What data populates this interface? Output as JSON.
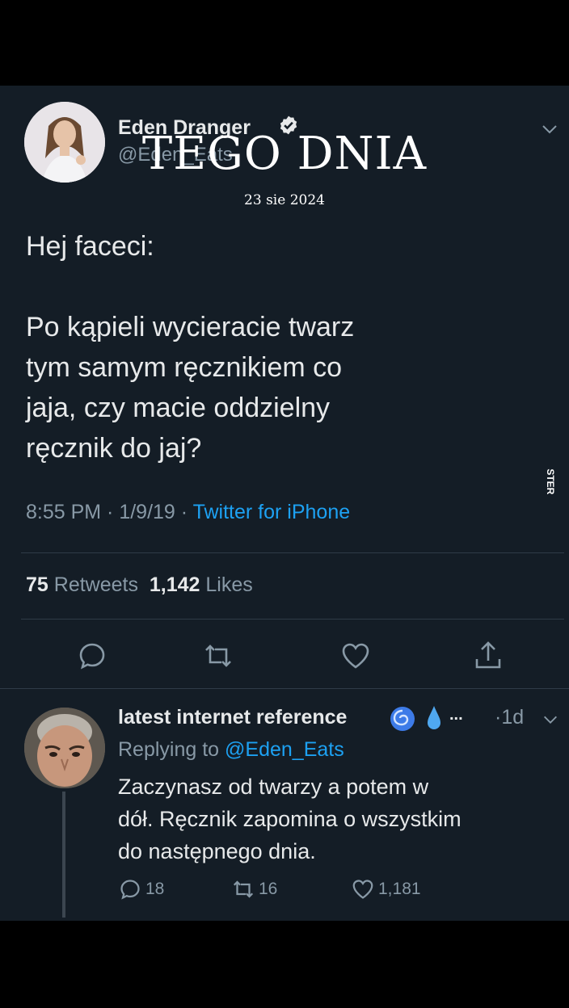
{
  "overlay": {
    "title": "TEGO DNIA",
    "date": "23 sie 2024"
  },
  "tweet": {
    "author_name": "Eden Dranger",
    "author_handle": "@Eden_Eats",
    "text_lines": [
      "Hej faceci:",
      "Po kąpieli wycieracie twarz",
      "tym samym ręcznikiem co",
      "jaja, czy macie oddzielny",
      "ręcznik do jaj?"
    ],
    "time": "8:55 PM",
    "date": "1/9/19",
    "source": "Twitter for iPhone",
    "retweets_count": "75",
    "retweets_label": "Retweets",
    "likes_count": "1,142",
    "likes_label": "Likes",
    "accent_color": "#1da1f2"
  },
  "watermark": "JOE MONSTER",
  "reply": {
    "author_name": "latest internet reference",
    "dots": "...",
    "time": "1d",
    "replying_to_label": "Replying to",
    "replying_to_handle": "@Eden_Eats",
    "text_lines": [
      "Zaczynasz od twarzy a potem w",
      "dół. Ręcznik zapomina o wszystkim",
      "do następnego dnia."
    ],
    "replies": "18",
    "retweets": "16",
    "likes": "1,181"
  }
}
